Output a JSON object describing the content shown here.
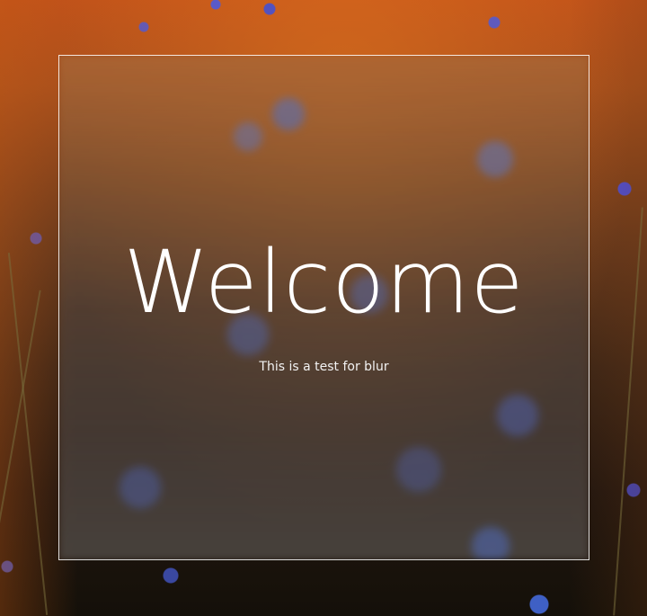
{
  "background": {
    "description_colors": {
      "warm": "#c0521a",
      "dark": "#141009",
      "flower": "#4a5ae0"
    }
  },
  "card": {
    "title": "Welcome",
    "subtitle": "This is a test for blur",
    "border_color": "#ffffff",
    "text_color": "#ffffff"
  }
}
